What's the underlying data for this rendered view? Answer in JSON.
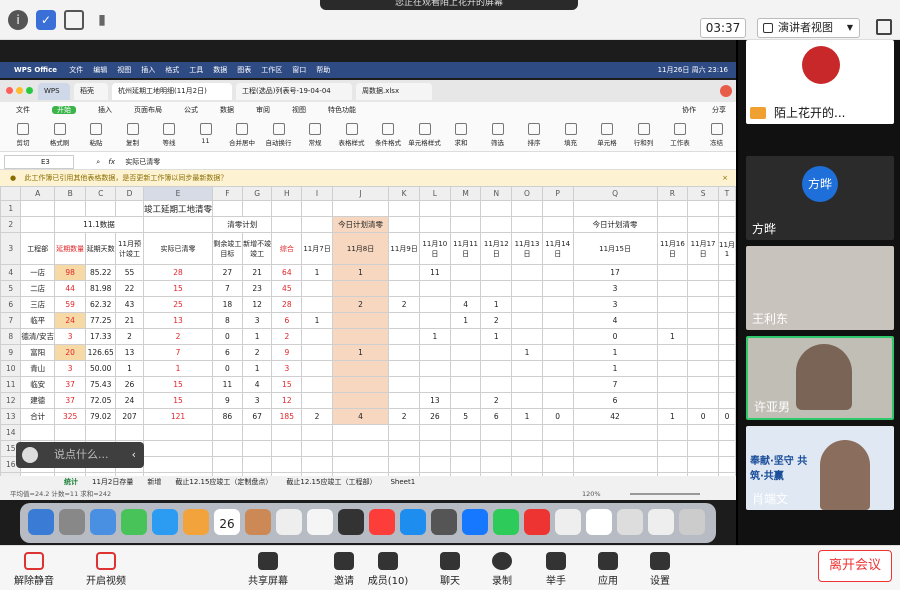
{
  "meeting": {
    "banner": "您正在观看陌上花开的屏幕",
    "timer": "03:37",
    "presenter_view": "演讲者视图",
    "leave": "离开会议"
  },
  "mac_menu": {
    "app": "WPS Office",
    "items": [
      "文件",
      "编辑",
      "视图",
      "插入",
      "格式",
      "工具",
      "数据",
      "图表",
      "工作区",
      "窗口",
      "帮助"
    ],
    "datetime": "11月26日 周六 23:16"
  },
  "wps": {
    "tabs": [
      "WPS",
      "稻壳",
      "杭州延期工地明细(11月2日)",
      "工程(选品)列表号-19-04-04",
      "周数据.xlsx"
    ],
    "menu": [
      "文件",
      "开始",
      "插入",
      "页面布局",
      "公式",
      "数据",
      "审阅",
      "视图",
      "特色功能"
    ],
    "ribbon": [
      "剪切",
      "格式刷",
      "粘贴",
      "复制",
      "等线",
      "11",
      "合并居中",
      "自动换行",
      "常规",
      "表格样式",
      "条件格式",
      "单元格样式",
      "求和",
      "筛选",
      "排序",
      "填充",
      "单元格",
      "行和列",
      "工作表",
      "冻结"
    ],
    "cell_ref": "E3",
    "formula": "实际已清零",
    "notice": "此工作簿已引用其他表格数据，是否更新工作簿以同步最新数据？",
    "share": "协作",
    "share2": "分享",
    "sheets": [
      "统计",
      "11月2日存量",
      "新增",
      "截止12.15应竣工（定制盘点）",
      "截止12.15应竣工（工程部）",
      "Sheet1"
    ],
    "status": "平均值=24.2  计数=11  求和=242",
    "zoom": "120%"
  },
  "sheet": {
    "col_headers": [
      "A",
      "B",
      "C",
      "D",
      "E",
      "F",
      "G",
      "H",
      "I",
      "J",
      "K",
      "L",
      "M",
      "N",
      "O",
      "P",
      "Q",
      "R",
      "S",
      "T"
    ],
    "title": "竣工延期工地清零",
    "group1": "11.1数据",
    "group2": "清零计划",
    "group3": "今日计划清零",
    "group4": "今日计划清零",
    "headers": [
      "工程部",
      "延期数量",
      "延期天数",
      "11月预计竣工",
      "实际已清零",
      "剩余竣工目标",
      "新增不竣竣工",
      "综合",
      "11月7日",
      "11月8日",
      "11月9日",
      "11月10日",
      "11月11日",
      "11月12日",
      "11月13日",
      "11月14日",
      "11月15日",
      "11月16日",
      "11月17日",
      "11月1"
    ],
    "rows": [
      [
        "一店",
        "98",
        "85.22",
        "55",
        "28",
        "27",
        "21",
        "64",
        "1",
        "1",
        "",
        "11",
        "",
        "",
        "",
        "",
        "17",
        "",
        "",
        ""
      ],
      [
        "二店",
        "44",
        "81.98",
        "22",
        "15",
        "7",
        "23",
        "45",
        "",
        "",
        "",
        "",
        "",
        "",
        "",
        "",
        "3",
        "",
        "",
        ""
      ],
      [
        "三店",
        "59",
        "62.32",
        "43",
        "25",
        "18",
        "12",
        "28",
        "",
        "2",
        "2",
        "",
        "4",
        "1",
        "",
        "",
        "3",
        "",
        "",
        ""
      ],
      [
        "临平",
        "24",
        "77.25",
        "21",
        "13",
        "8",
        "3",
        "6",
        "1",
        "",
        "",
        "",
        "1",
        "2",
        "",
        "",
        "4",
        "",
        "",
        ""
      ],
      [
        "德清/安吉",
        "3",
        "17.33",
        "2",
        "2",
        "0",
        "1",
        "2",
        "",
        "",
        "",
        "1",
        "",
        "1",
        "",
        "",
        "0",
        "1",
        "",
        ""
      ],
      [
        "富阳",
        "20",
        "126.65",
        "13",
        "7",
        "6",
        "2",
        "9",
        "",
        "1",
        "",
        "",
        "",
        "",
        "1",
        "",
        "1",
        "",
        "",
        ""
      ],
      [
        "青山",
        "3",
        "50.00",
        "1",
        "1",
        "0",
        "1",
        "3",
        "",
        "",
        "",
        "",
        "",
        "",
        "",
        "",
        "1",
        "",
        "",
        ""
      ],
      [
        "临安",
        "37",
        "75.43",
        "26",
        "15",
        "11",
        "4",
        "15",
        "",
        "",
        "",
        "",
        "",
        "",
        "",
        "",
        "7",
        "",
        "",
        ""
      ],
      [
        "建德",
        "37",
        "72.05",
        "24",
        "15",
        "9",
        "3",
        "12",
        "",
        "",
        "",
        "13",
        "",
        "2",
        "",
        "",
        "6",
        "",
        "",
        ""
      ],
      [
        "合计",
        "325",
        "79.02",
        "207",
        "121",
        "86",
        "67",
        "185",
        "2",
        "4",
        "2",
        "26",
        "5",
        "6",
        "1",
        "0",
        "42",
        "1",
        "0",
        "0"
      ]
    ]
  },
  "chat": {
    "placeholder": "说点什么..."
  },
  "participants": [
    {
      "name": "陌上花开的...",
      "type": "screen"
    },
    {
      "name": "方晔",
      "type": "avatar",
      "avatar": "方晔"
    },
    {
      "name": "王利东",
      "type": "camera"
    },
    {
      "name": "许亚男",
      "type": "camera"
    },
    {
      "name": "肖端文",
      "type": "camera",
      "poster": "奉献·坚守 共筑·共赢"
    }
  ],
  "toolbar": [
    {
      "label": "解除静音",
      "icon": "mic-muted-icon"
    },
    {
      "label": "开启视频",
      "icon": "video-off-icon"
    },
    {
      "label": "共享屏幕",
      "icon": "share-screen-icon"
    },
    {
      "label": "邀请",
      "icon": "invite-icon"
    },
    {
      "label": "成员(10)",
      "icon": "members-icon"
    },
    {
      "label": "聊天",
      "icon": "chat-icon"
    },
    {
      "label": "录制",
      "icon": "record-icon"
    },
    {
      "label": "举手",
      "icon": "hand-icon"
    },
    {
      "label": "应用",
      "icon": "apps-icon"
    },
    {
      "label": "设置",
      "icon": "gear-icon"
    }
  ],
  "dock": {
    "calendar_day": "26",
    "calendar_month": "11月"
  }
}
